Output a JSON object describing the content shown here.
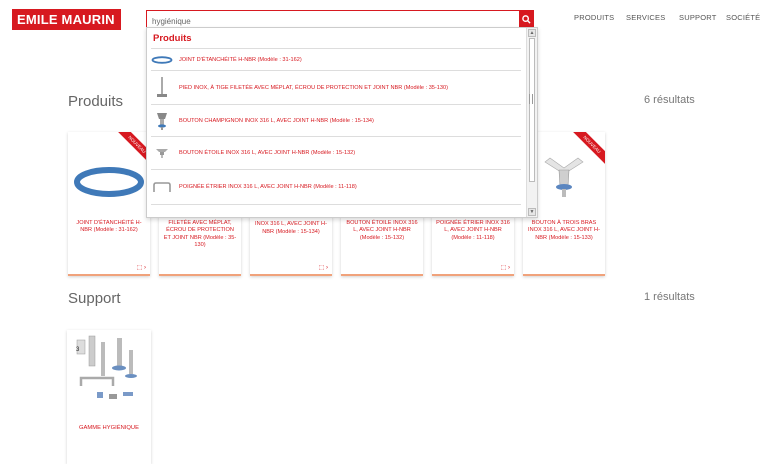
{
  "header": {
    "logo": "EMILE MAURIN",
    "search_value": "hygiénique",
    "nav": [
      "PRODUITS",
      "SERVICES",
      "SUPPORT",
      "SOCIÉTÉ"
    ]
  },
  "dropdown": {
    "heading": "Produits",
    "items": [
      {
        "label": "JOINT D'ÉTANCHÉITÉ H-NBR (Modèle : 31-162)",
        "icon": "ring-seal-icon"
      },
      {
        "label": "PIED INOX, À TIGE FILETÉE AVEC MÉPLAT, ÉCROU DE PROTECTION ET JOINT NBR (Modèle : 35-130)",
        "icon": "threaded-foot-icon"
      },
      {
        "label": "BOUTON CHAMPIGNON INOX 316 L, AVEC JOINT H-NBR (Modèle : 15-134)",
        "icon": "mushroom-knob-icon"
      },
      {
        "label": "BOUTON ÉTOILE INOX 316 L, AVEC JOINT H-NBR (Modèle : 15-132)",
        "icon": "star-knob-icon"
      },
      {
        "label": "POIGNÉE ÉTRIER INOX 316 L, AVEC JOINT H-NBR (Modèle : 11-118)",
        "icon": "stirrup-handle-icon"
      }
    ]
  },
  "produits": {
    "title": "Produits",
    "count": "6 résultats",
    "badge": "NOUVEAU",
    "cards": [
      {
        "name": "JOINT D'ÉTANCHÉITÉ H-NBR (Modèle : 31-162)",
        "new": true,
        "pdf": true
      },
      {
        "name": "FILETÉE AVEC MÉPLAT, ÉCROU DE PROTECTION ET JOINT NBR (Modèle : 35-130)",
        "new": false,
        "pdf": false
      },
      {
        "name": "BOUTON CHAMPIGNON INOX 316 L, AVEC JOINT H-NBR (Modèle : 15-134)",
        "new": false,
        "pdf": true
      },
      {
        "name": "BOUTON ÉTOILE INOX 316 L, AVEC JOINT H-NBR (Modèle : 15-132)",
        "new": false,
        "pdf": false
      },
      {
        "name": "POIGNÉE ÉTRIER INOX 316 L, AVEC JOINT H-NBR (Modèle : 11-118)",
        "new": false,
        "pdf": true
      },
      {
        "name": "BOUTON À TROIS BRAS INOX 316 L, AVEC JOINT H-NBR (Modèle : 15-133)",
        "new": true,
        "pdf": false
      }
    ]
  },
  "support": {
    "title": "Support",
    "count": "1 résultats",
    "card_name": "GAMME HYGIÉNIQUE"
  },
  "colors": {
    "brand": "#d71920",
    "accent_border": "#f0a27b"
  }
}
